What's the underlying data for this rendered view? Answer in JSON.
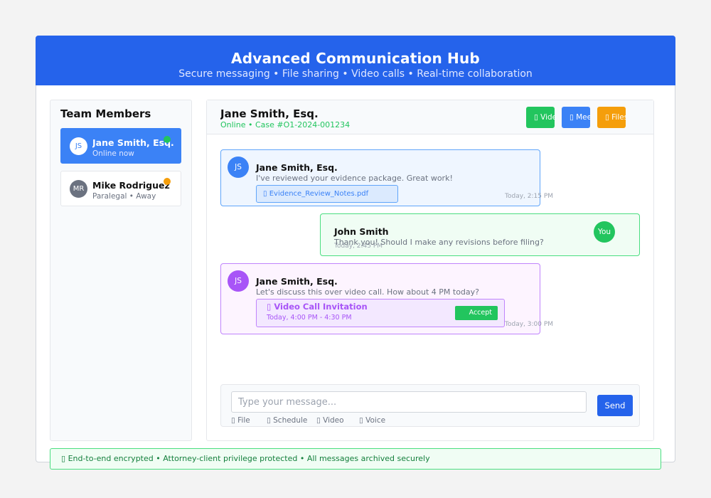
{
  "header": {
    "title": "Advanced Communication Hub",
    "subtitle": "Secure messaging • File sharing • Video calls • Real-time collaboration"
  },
  "sidebar": {
    "title": "Team Members",
    "members": [
      {
        "initials": "JS",
        "name": "Jane Smith, Esq.",
        "status": "Online now",
        "presence_color": "#22c55e"
      },
      {
        "initials": "MR",
        "name": "Mike Rodriguez",
        "status": "Paralegal • Away",
        "presence_color": "#f59e0b"
      }
    ]
  },
  "chat": {
    "contact_name": "Jane Smith, Esq.",
    "contact_status": "Online • Case #O1-2024-001234",
    "header_buttons": [
      {
        "icon": "video-icon",
        "label": "Video"
      },
      {
        "icon": "meeting-icon",
        "label": "Meet"
      },
      {
        "icon": "folder-icon",
        "label": "Files"
      }
    ],
    "messages": [
      {
        "avatar": "JS",
        "sender": "Jane Smith, Esq.",
        "text": "I've reviewed your evidence package. Great work!",
        "attachment": "Evidence_Review_Notes.pdf",
        "time": "Today, 2:15 PM"
      },
      {
        "avatar": "You",
        "sender": "John Smith",
        "text": "Thank you! Should I make any revisions before filing?",
        "time": "Today, 2:45 PM"
      },
      {
        "avatar": "JS",
        "sender": "Jane Smith, Esq.",
        "text": "Let's discuss this over video call. How about 4 PM today?",
        "invite": {
          "title": "Video Call Invitation",
          "time": "Today, 4:00 PM - 4:30 PM",
          "accept_label": "Accept"
        },
        "time": "Today, 3:00 PM"
      }
    ]
  },
  "composer": {
    "placeholder": "Type your message...",
    "send_label": "Send",
    "tools": [
      {
        "icon": "paperclip-icon",
        "label": "File"
      },
      {
        "icon": "calendar-icon",
        "label": "Schedule"
      },
      {
        "icon": "video-icon",
        "label": "Video"
      },
      {
        "icon": "microphone-icon",
        "label": "Voice"
      }
    ]
  },
  "footer": {
    "icon": "lock-icon",
    "text": "End-to-end encrypted • Attorney-client privilege protected • All messages archived securely"
  },
  "colors": {
    "brand": "#2563eb",
    "online": "#22c55e",
    "away": "#f59e0b",
    "accent_purple": "#a855f7"
  }
}
